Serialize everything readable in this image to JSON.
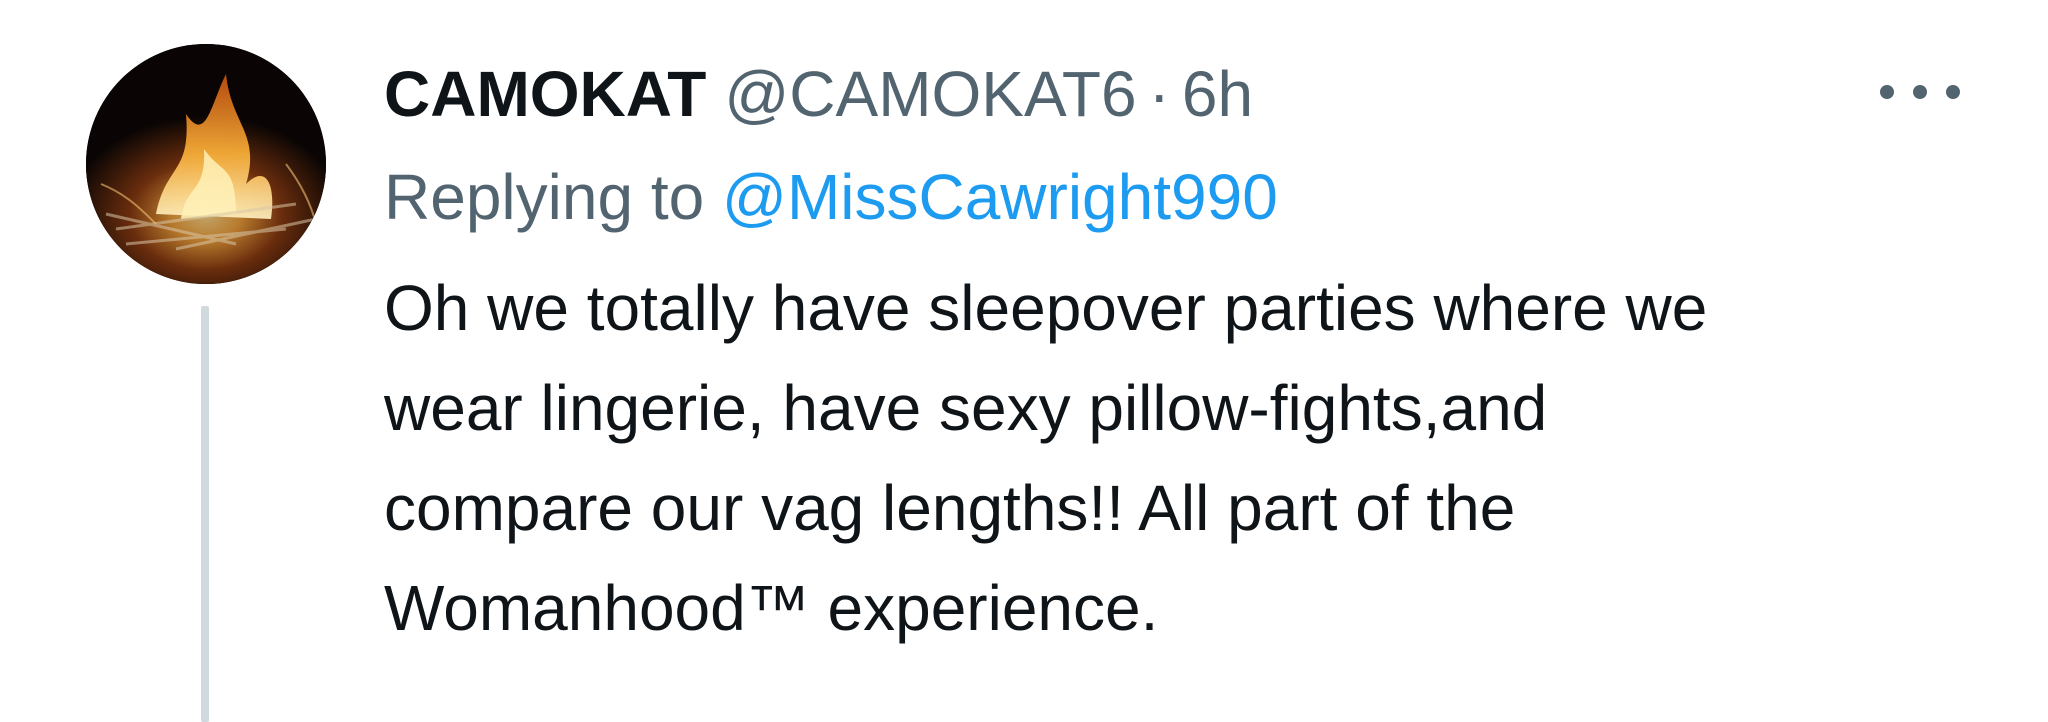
{
  "tweet": {
    "display_name": "CAMOKAT",
    "handle": "@CAMOKAT6",
    "separator": "·",
    "time": "6h",
    "reply_prefix": "Replying to",
    "reply_to": "@MissCawright990",
    "body_lines": [
      "Oh we totally have sleepover parties where we",
      "wear lingerie, have sexy pillow-fights,and",
      "compare our vag lengths!! All part of the",
      "Womanhood™ experience."
    ]
  },
  "icons": {
    "avatar": "bonfire-avatar-image",
    "more": "more-options-icon"
  },
  "colors": {
    "text_primary": "#0f1419",
    "text_secondary": "#536471",
    "link": "#1d9bf0",
    "thread_line": "#cfd9de"
  }
}
